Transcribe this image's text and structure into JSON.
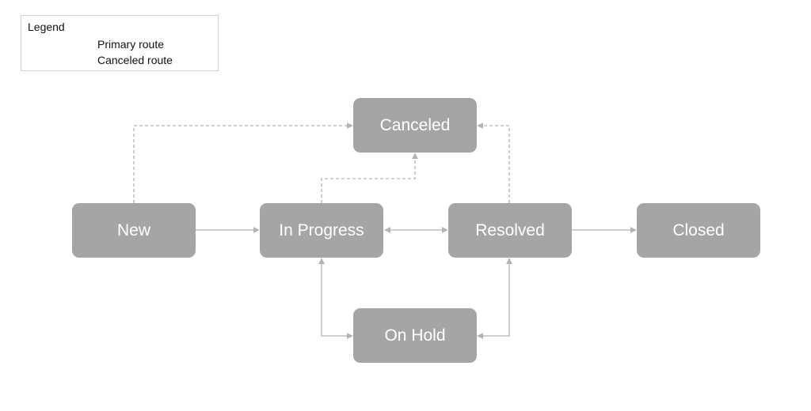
{
  "legend": {
    "title": "Legend",
    "items": [
      {
        "label": "Primary route",
        "style": "solid"
      },
      {
        "label": "Canceled route",
        "style": "dashed"
      }
    ]
  },
  "nodes": {
    "new": "New",
    "in_progress": "In Progress",
    "resolved": "Resolved",
    "closed": "Closed",
    "canceled": "Canceled",
    "on_hold": "On Hold"
  },
  "edges": [
    {
      "from": "New",
      "to": "In Progress",
      "type": "primary"
    },
    {
      "from": "In Progress",
      "to": "Resolved",
      "type": "primary",
      "bidirectional": true
    },
    {
      "from": "Resolved",
      "to": "Closed",
      "type": "primary"
    },
    {
      "from": "In Progress",
      "to": "On Hold",
      "type": "primary",
      "bidirectional": true
    },
    {
      "from": "Resolved",
      "to": "On Hold",
      "type": "primary",
      "bidirectional": true
    },
    {
      "from": "New",
      "to": "Canceled",
      "type": "canceled"
    },
    {
      "from": "In Progress",
      "to": "Canceled",
      "type": "canceled"
    },
    {
      "from": "Resolved",
      "to": "Canceled",
      "type": "canceled"
    }
  ],
  "colors": {
    "node_fill": "#a5a5a5",
    "node_text": "#ffffff",
    "edge": "#b3b3b3",
    "legend_border": "#d0d0d0"
  }
}
